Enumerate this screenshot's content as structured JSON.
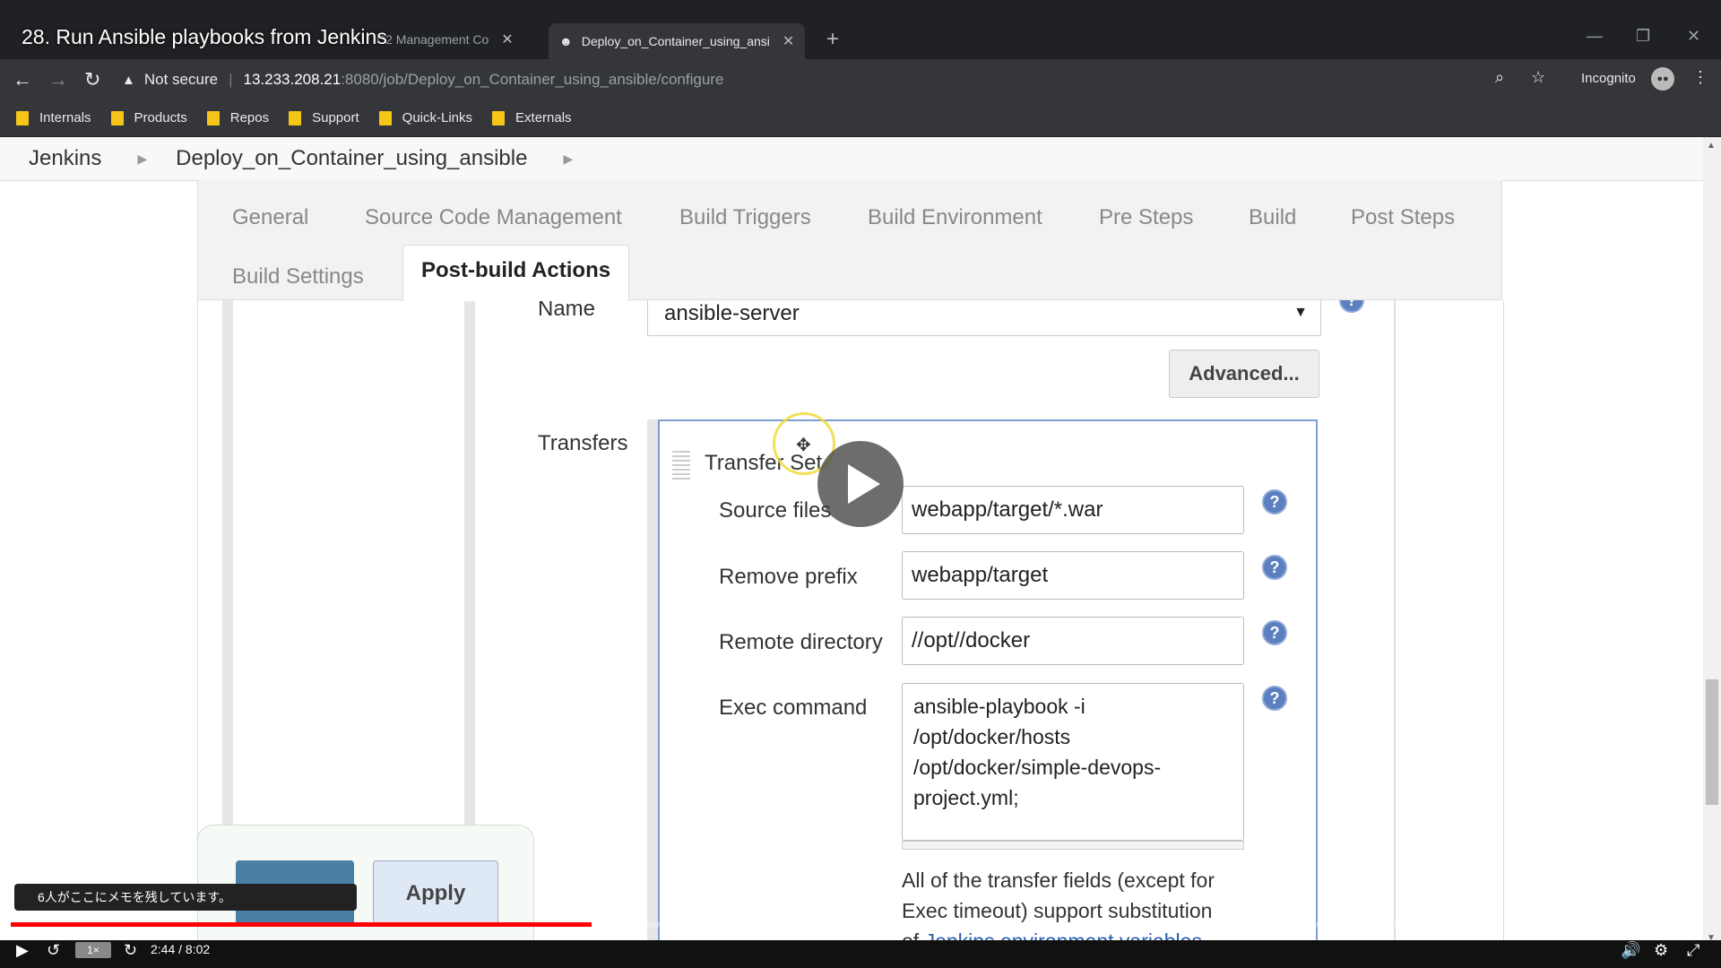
{
  "video": {
    "title": "28. Run Ansible playbooks from Jenkins",
    "time": "2:44 / 8:02",
    "speed": "1×",
    "memo_tip": "6人がここにメモを残しています。",
    "progress_fraction": 0.41
  },
  "browser": {
    "tabs": [
      {
        "label": "C2 Management Co",
        "active": false
      },
      {
        "label": "Deploy_on_Container_using_ansi",
        "active": true
      }
    ],
    "address": {
      "security": "Not secure",
      "host": "13.233.208.21",
      "path": ":8080/job/Deploy_on_Container_using_ansible/configure"
    },
    "incognito_label": "Incognito",
    "bookmarks": [
      "Internals",
      "Products",
      "Repos",
      "Support",
      "Quick-Links",
      "Externals"
    ]
  },
  "jenkins": {
    "breadcrumb": [
      "Jenkins",
      "Deploy_on_Container_using_ansible"
    ],
    "config_tabs": [
      "General",
      "Source Code Management",
      "Build Triggers",
      "Build Environment",
      "Pre Steps",
      "Build",
      "Post Steps",
      "Build Settings",
      "Post-build Actions"
    ],
    "active_tab": "Post-build Actions",
    "name_label": "Name",
    "name_value": "ansible-server",
    "advanced_label": "Advanced...",
    "transfers_label": "Transfers",
    "transfer_set": {
      "title": "Transfer Set",
      "source_files_label": "Source files",
      "source_files": "webapp/target/*.war",
      "remove_prefix_label": "Remove prefix",
      "remove_prefix": "webapp/target",
      "remote_directory_label": "Remote directory",
      "remote_directory": "//opt//docker",
      "exec_command_label": "Exec command",
      "exec_command": "ansible-playbook -i\n/opt/docker/hosts\n/opt/docker/simple-devops-\nproject.yml;",
      "help_text_1": "All of the transfer fields (except for",
      "help_text_2": "Exec timeout) support substitution",
      "help_text_3": "of ",
      "help_link": "Jenkins environment variables"
    },
    "apply_label": "Apply"
  }
}
